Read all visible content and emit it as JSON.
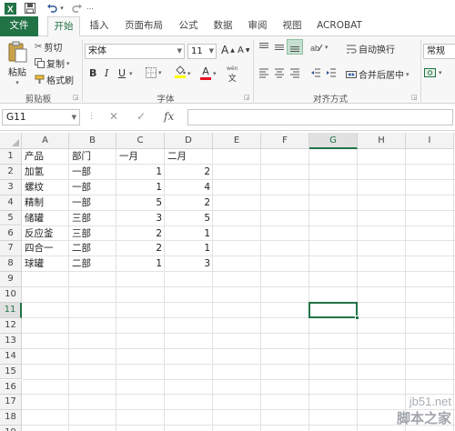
{
  "quick_access": {
    "excel_icon": "excel-logo-icon",
    "save_icon": "save-icon",
    "undo_icon": "undo-icon",
    "redo_icon": "redo-icon"
  },
  "tabs": [
    {
      "label": "文件"
    },
    {
      "label": "开始"
    },
    {
      "label": "插入"
    },
    {
      "label": "页面布局"
    },
    {
      "label": "公式"
    },
    {
      "label": "数据"
    },
    {
      "label": "审阅"
    },
    {
      "label": "视图"
    },
    {
      "label": "ACROBAT"
    }
  ],
  "ribbon": {
    "clipboard": {
      "paste": "粘贴",
      "cut": "剪切",
      "copy": "复制",
      "format_painter": "格式刷",
      "group": "剪贴板"
    },
    "font": {
      "name": "宋体",
      "size": "11",
      "grow": "A",
      "shrink": "A",
      "bold": "B",
      "italic": "I",
      "underline": "U",
      "font_color": "A",
      "wen": "wén",
      "group": "字体"
    },
    "alignment": {
      "wrap_text": "自动换行",
      "merge_center": "合并后居中",
      "group": "对齐方式"
    },
    "number": {
      "format": "常规"
    }
  },
  "formula_bar": {
    "name_box": "G11",
    "fx": "fx",
    "cancel": "✕",
    "enter": "✓",
    "value": ""
  },
  "grid": {
    "columns": [
      "A",
      "B",
      "C",
      "D",
      "E",
      "F",
      "G",
      "H",
      "I"
    ],
    "rows": [
      "1",
      "2",
      "3",
      "4",
      "5",
      "6",
      "7",
      "8",
      "9",
      "10",
      "11",
      "12",
      "13",
      "14",
      "15",
      "16",
      "17",
      "18",
      "19"
    ],
    "selected_cell": "G11",
    "headers": [
      "产品",
      "部门",
      "一月",
      "二月"
    ],
    "data": [
      [
        "加氢",
        "一部",
        "1",
        "2"
      ],
      [
        "螺纹",
        "一部",
        "1",
        "4"
      ],
      [
        "精制",
        "一部",
        "5",
        "2"
      ],
      [
        "储罐",
        "三部",
        "3",
        "5"
      ],
      [
        "反应釜",
        "三部",
        "2",
        "1"
      ],
      [
        "四合一",
        "二部",
        "2",
        "1"
      ],
      [
        "球罐",
        "二部",
        "1",
        "3"
      ]
    ]
  },
  "watermark": {
    "site": "jb51.net",
    "name": "脚本之家"
  }
}
